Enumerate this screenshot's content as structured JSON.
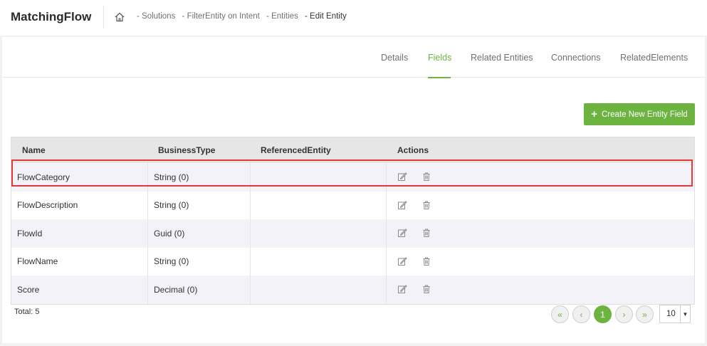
{
  "app": {
    "title": "MatchingFlow"
  },
  "breadcrumb": [
    {
      "label": "- Solutions"
    },
    {
      "label": "- FilterEntity on Intent"
    },
    {
      "label": "- Entities"
    },
    {
      "label": "- Edit Entity"
    }
  ],
  "tabs": [
    {
      "label": "Details"
    },
    {
      "label": "Fields"
    },
    {
      "label": "Related Entities"
    },
    {
      "label": "Connections"
    },
    {
      "label": "RelatedElements"
    }
  ],
  "active_tab": "Fields",
  "create_button": {
    "label": "Create New Entity Field",
    "icon": "plus-icon"
  },
  "table": {
    "columns": [
      "Name",
      "BusinessType",
      "ReferencedEntity",
      "Actions"
    ],
    "rows": [
      {
        "name": "FlowCategory",
        "type": "String (0)",
        "ref": ""
      },
      {
        "name": "FlowDescription",
        "type": "String (0)",
        "ref": ""
      },
      {
        "name": "FlowId",
        "type": "Guid (0)",
        "ref": ""
      },
      {
        "name": "FlowName",
        "type": "String (0)",
        "ref": ""
      },
      {
        "name": "Score",
        "type": "Decimal (0)",
        "ref": ""
      }
    ],
    "action_icons": [
      "edit-icon",
      "trash-icon"
    ],
    "highlighted_row": 0
  },
  "footer": {
    "total": "Total: 5",
    "pager": {
      "first": "«",
      "prev": "‹",
      "current": "1",
      "next": "›",
      "last": "»"
    },
    "page_size": "10"
  },
  "colors": {
    "accent": "#6db33f",
    "highlight": "#e53935",
    "header_bg": "#e6e6e6",
    "alt_row": "#f2f2f8"
  }
}
